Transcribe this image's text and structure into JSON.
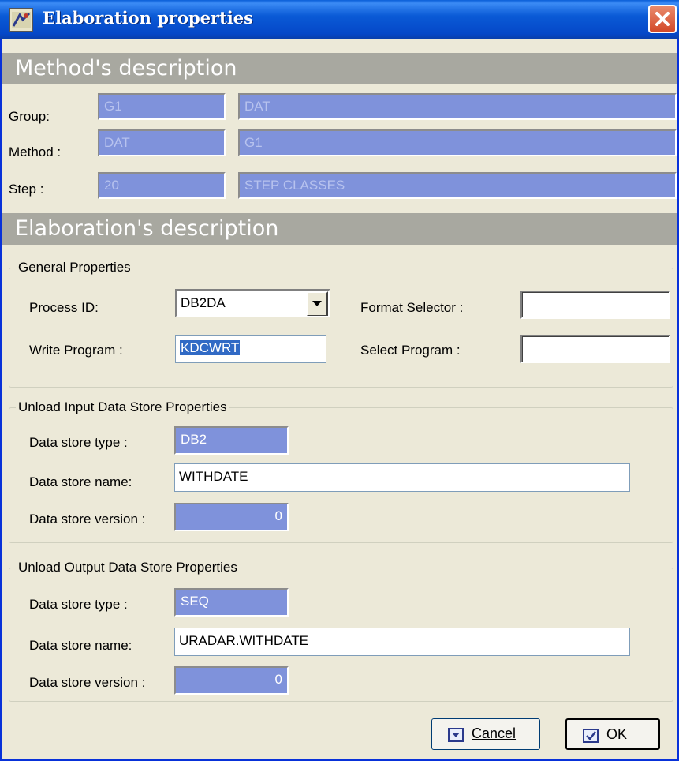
{
  "window": {
    "title": "Elaboration properties"
  },
  "method_section": {
    "heading": "Method's description",
    "group": {
      "label": "Group:",
      "code": "G1",
      "name": "DAT"
    },
    "method": {
      "label": "Method :",
      "code": "DAT",
      "name": "G1"
    },
    "step": {
      "label": "Step :",
      "code": "20",
      "name": "STEP CLASSES"
    }
  },
  "elaboration_section": {
    "heading": "Elaboration's description",
    "general": {
      "title": "General Properties",
      "process_id_label": "Process ID:",
      "process_id_value": "DB2DA",
      "write_program_label": "Write Program :",
      "write_program_value": "KDCWRT",
      "format_selector_label": "Format Selector :",
      "format_selector_value": "",
      "select_program_label": "Select Program :",
      "select_program_value": ""
    },
    "unload_input": {
      "title": "Unload Input Data Store Properties",
      "type_label": "Data store type :",
      "type_value": "DB2",
      "name_label": "Data store name:",
      "name_value": "WITHDATE",
      "version_label": "Data store version :",
      "version_value": "0"
    },
    "unload_output": {
      "title": "Unload Output Data Store Properties",
      "type_label": "Data store type :",
      "type_value": "SEQ",
      "name_label": "Data store name:",
      "name_value": "URADAR.WITHDATE",
      "version_label": "Data store version :",
      "version_value": "0"
    }
  },
  "buttons": {
    "cancel": "Cancel",
    "ok": "OK"
  },
  "colors": {
    "readonly_fill": "#7f92db",
    "band": "#a8a8a0",
    "titlebar": "#0a5ad6",
    "close": "#d34a2a"
  },
  "icons": {
    "app": "app-icon",
    "close": "close-icon",
    "dropdown": "chevron-down-icon",
    "cancel": "cancel-check-icon",
    "ok": "ok-check-icon"
  }
}
